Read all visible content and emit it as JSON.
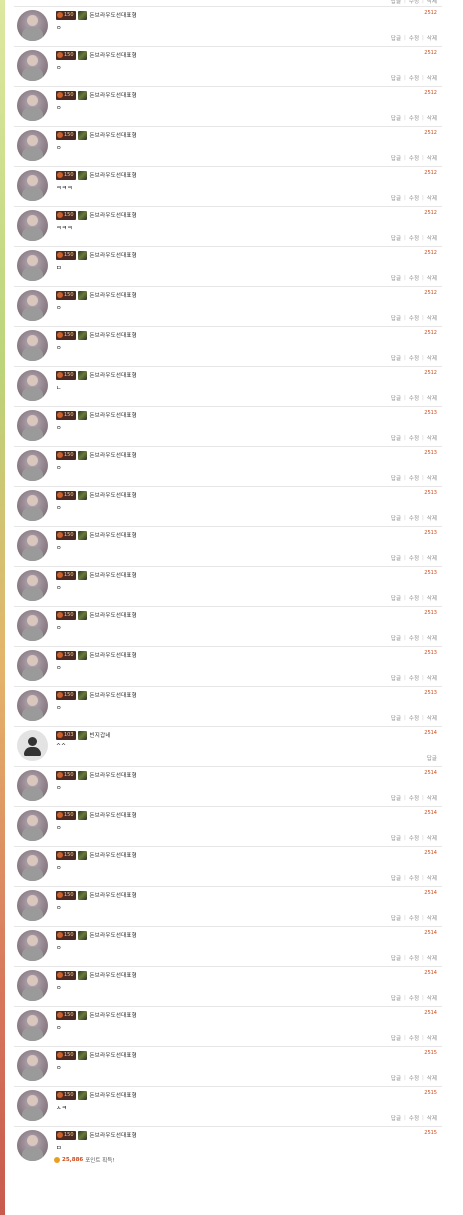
{
  "labels": {
    "reply": "답글",
    "edit": "수정",
    "delete": "삭제",
    "sep": "|"
  },
  "comments": [
    {
      "level": "150",
      "nick": "돈브라우도선대표형",
      "time": "2512",
      "text": "ㅇ",
      "actions": "full"
    },
    {
      "level": "150",
      "nick": "돈브라우도선대표형",
      "time": "2512",
      "text": "ㅇ",
      "actions": "full"
    },
    {
      "level": "150",
      "nick": "돈브라우도선대표형",
      "time": "2512",
      "text": "ㅇ",
      "actions": "full"
    },
    {
      "level": "150",
      "nick": "돈브라우도선대표형",
      "time": "2512",
      "text": "ㅇ",
      "actions": "full"
    },
    {
      "level": "150",
      "nick": "돈브라우도선대표형",
      "time": "2512",
      "text": "ㅋㅋㅋ",
      "actions": "full"
    },
    {
      "level": "150",
      "nick": "돈브라우도선대표형",
      "time": "2512",
      "text": "ㅋㅋㅋ",
      "actions": "full"
    },
    {
      "level": "150",
      "nick": "돈브라우도선대표형",
      "time": "2512",
      "text": "ㅁ",
      "actions": "full"
    },
    {
      "level": "150",
      "nick": "돈브라우도선대표형",
      "time": "2512",
      "text": "ㅇ",
      "actions": "full"
    },
    {
      "level": "150",
      "nick": "돈브라우도선대표형",
      "time": "2512",
      "text": "ㅇ",
      "actions": "full"
    },
    {
      "level": "150",
      "nick": "돈브라우도선대표형",
      "time": "2512",
      "text": "ㄴ",
      "actions": "full"
    },
    {
      "level": "150",
      "nick": "돈브라우도선대표형",
      "time": "2513",
      "text": "ㅇ",
      "actions": "full"
    },
    {
      "level": "150",
      "nick": "돈브라우도선대표형",
      "time": "2513",
      "text": "ㅇ",
      "actions": "full"
    },
    {
      "level": "150",
      "nick": "돈브라우도선대표형",
      "time": "2513",
      "text": "ㅇ",
      "actions": "full"
    },
    {
      "level": "150",
      "nick": "돈브라우도선대표형",
      "time": "2513",
      "text": "ㅇ",
      "actions": "full"
    },
    {
      "level": "150",
      "nick": "돈브라우도선대표형",
      "time": "2513",
      "text": "ㅇ",
      "actions": "full"
    },
    {
      "level": "150",
      "nick": "돈브라우도선대표형",
      "time": "2513",
      "text": "ㅇ",
      "actions": "full"
    },
    {
      "level": "150",
      "nick": "돈브라우도선대표형",
      "time": "2513",
      "text": "ㅇ",
      "actions": "full"
    },
    {
      "level": "150",
      "nick": "돈브라우도선대표형",
      "time": "2513",
      "text": "ㅇ",
      "actions": "full"
    },
    {
      "level": "103",
      "nick": "빈지갑네",
      "time": "2514",
      "text": "^^",
      "actions": "reply",
      "avatar": "default"
    },
    {
      "level": "150",
      "nick": "돈브라우도선대표형",
      "time": "2514",
      "text": "ㅇ",
      "actions": "full"
    },
    {
      "level": "150",
      "nick": "돈브라우도선대표형",
      "time": "2514",
      "text": "ㅇ",
      "actions": "full"
    },
    {
      "level": "150",
      "nick": "돈브라우도선대표형",
      "time": "2514",
      "text": "ㅇ",
      "actions": "full"
    },
    {
      "level": "150",
      "nick": "돈브라우도선대표형",
      "time": "2514",
      "text": "ㅇ",
      "actions": "full"
    },
    {
      "level": "150",
      "nick": "돈브라우도선대표형",
      "time": "2514",
      "text": "ㅇ",
      "actions": "full"
    },
    {
      "level": "150",
      "nick": "돈브라우도선대표형",
      "time": "2514",
      "text": "ㅇ",
      "actions": "full"
    },
    {
      "level": "150",
      "nick": "돈브라우도선대표형",
      "time": "2514",
      "text": "ㅇ",
      "actions": "full"
    },
    {
      "level": "150",
      "nick": "돈브라우도선대표형",
      "time": "2515",
      "text": "ㅇ",
      "actions": "full"
    },
    {
      "level": "150",
      "nick": "돈브라우도선대표형",
      "time": "2515",
      "text": "ㅅㅋ",
      "actions": "full"
    },
    {
      "level": "150",
      "nick": "돈브라우도선대표형",
      "time": "2515",
      "text": "ㅁ",
      "actions": "points",
      "points": {
        "value": "25,886",
        "suffix": "포인트 획득!"
      }
    }
  ],
  "colors": {
    "time": "#d04a1a",
    "divider": "#e6e6e6"
  }
}
